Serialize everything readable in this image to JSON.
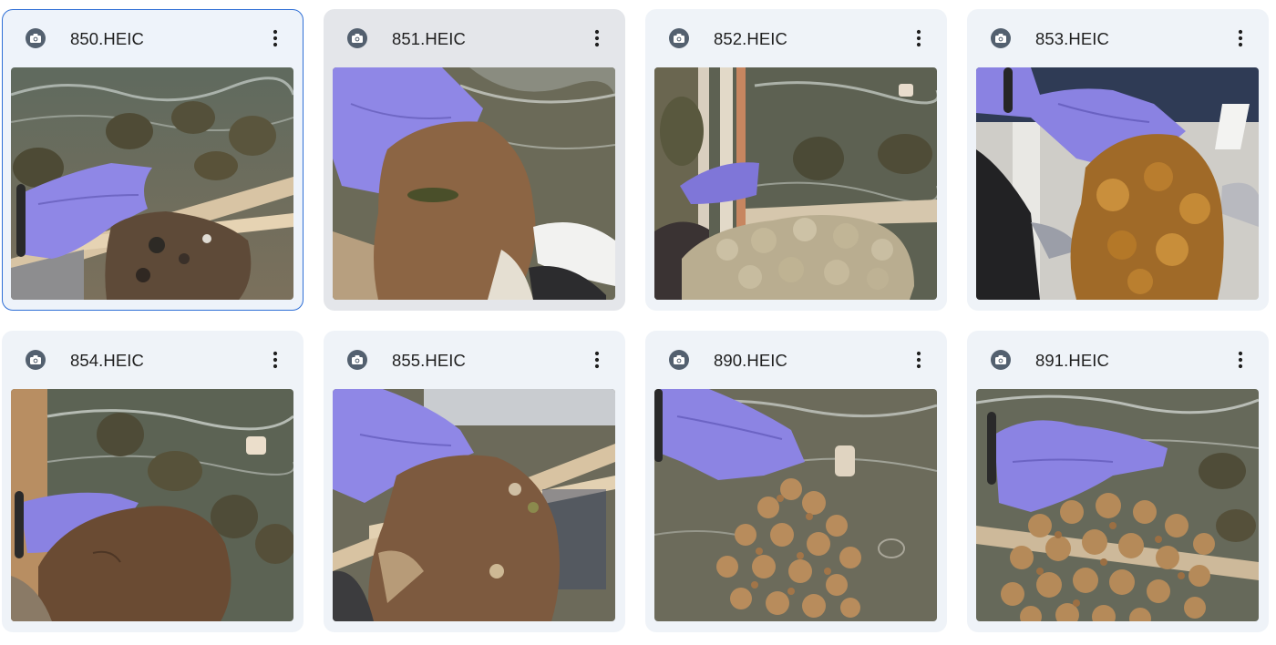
{
  "files": [
    {
      "name": "850.HEIC",
      "state": "selected",
      "subject": "brown massive coral held by purple-gloved hand over tank"
    },
    {
      "name": "851.HEIC",
      "state": "hovered",
      "subject": "brown encrusting coral held by purple-gloved hand"
    },
    {
      "name": "852.HEIC",
      "state": "normal",
      "subject": "pale bumpy coral in tank"
    },
    {
      "name": "853.HEIC",
      "state": "normal",
      "subject": "yellow-brown lobed coral held up"
    },
    {
      "name": "854.HEIC",
      "state": "normal",
      "subject": "brown plate coral in tank"
    },
    {
      "name": "855.HEIC",
      "state": "normal",
      "subject": "brown encrusting coral fragment held up"
    },
    {
      "name": "890.HEIC",
      "state": "normal",
      "subject": "branching tan coral held by purple glove"
    },
    {
      "name": "891.HEIC",
      "state": "normal",
      "subject": "branching tan coral held over tank"
    }
  ],
  "icons": {
    "type": "camera-icon",
    "more": "more-vert-icon"
  },
  "colors": {
    "card_bg": "#eff3f8",
    "selected_border": "#2f6fd6",
    "hover_bg": "#e4e6ea",
    "glove": "#8f87e6",
    "water": "#6a6a58"
  }
}
